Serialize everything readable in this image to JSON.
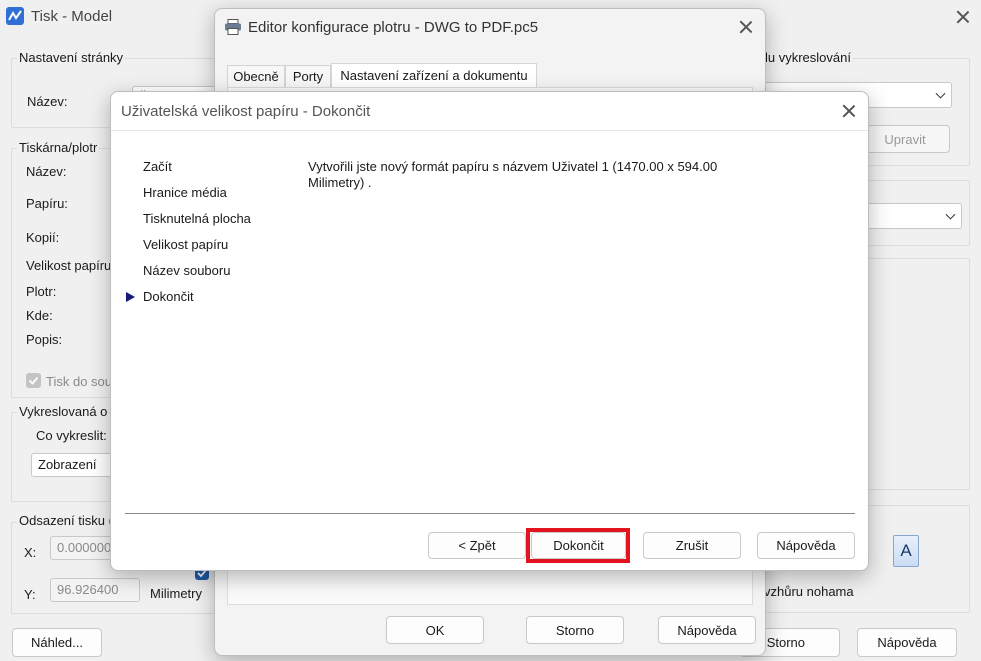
{
  "main": {
    "title": "Tisk - Model",
    "page_setup": {
      "legend": "Nastavení stránky",
      "name_label": "Název:",
      "name_value": "Ž"
    },
    "printer": {
      "legend": "Tiskárna/plotr",
      "name_label": "Název:",
      "paper_label": "Papíru:",
      "copies_label": "Kopií:",
      "paper_size_label": "Velikost papíru",
      "plotter_label": "Plotr:",
      "where_label": "Kde:",
      "desc_label": "Popis:",
      "print_to_file_label": "Tisk do sou"
    },
    "plot_area": {
      "legend": "Vykreslovaná o",
      "what_label": "Co vykreslit:",
      "what_value": "Zobrazení"
    },
    "plot_offset": {
      "legend": "Odsazení tisku (",
      "x_label": "X:",
      "x_value": "0.000000",
      "y_label": "Y:",
      "y_value": "96.926400",
      "units": "Milimetry"
    },
    "right": {
      "style_legend": "lu vykreslování",
      "edit_button": "Upravit",
      "orientation_text": "vzhůru nohama",
      "orientation_icon_letter": "A"
    },
    "buttons": {
      "preview": "Náhled...",
      "cancel": "Storno",
      "help": "Nápověda"
    }
  },
  "plotter_editor": {
    "title": "Editor konfigurace plotru - DWG to PDF.pc5",
    "tabs": [
      "Obecně",
      "Porty",
      "Nastavení zařízení a dokumentu"
    ],
    "buttons": {
      "ok": "OK",
      "cancel": "Storno",
      "help": "Nápověda"
    }
  },
  "wizard": {
    "title": "Uživatelská velikost papíru - Dokončit",
    "steps": [
      "Začít",
      "Hranice média",
      "Tisknutelná plocha",
      "Velikost papíru",
      "Název souboru",
      "Dokončit"
    ],
    "active_step_index": 5,
    "message": "Vytvořili jste nový formát papíru s názvem Uživatel 1 (1470.00 x 594.00 Milimetry) .",
    "buttons": {
      "back": "< Zpět",
      "finish": "Dokončit",
      "cancel": "Zrušit",
      "help": "Nápověda"
    },
    "highlight_color": "#e3141d"
  }
}
